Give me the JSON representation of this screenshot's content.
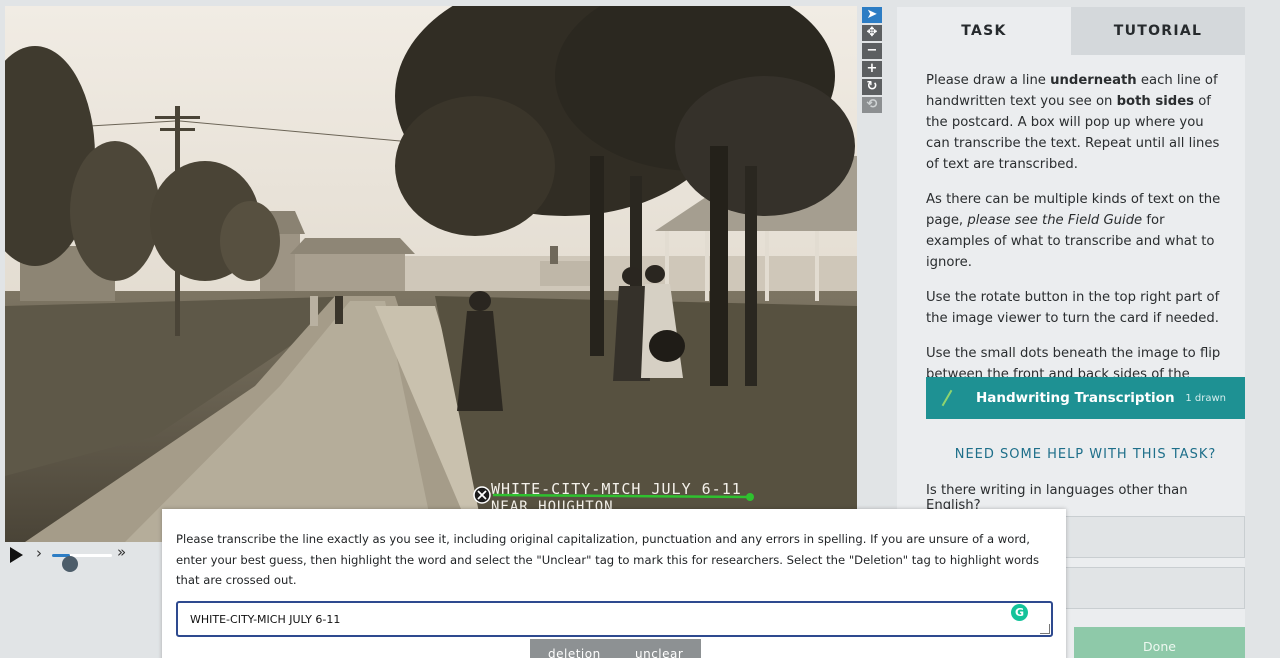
{
  "tabs": [
    {
      "label": "TASK",
      "active": true
    },
    {
      "label": "TUTORIAL",
      "active": false
    }
  ],
  "instructions": {
    "p1": {
      "t1": "Please draw a line ",
      "b1": "underneath",
      "t2": " each line of handwritten text you see on ",
      "b2": "both sides",
      "t3": " of the postcard. A box will pop up where you can transcribe the text. Repeat until all lines of text are transcribed."
    },
    "p2": {
      "t1": "As there can be multiple kinds of text on the page, ",
      "i1": "please see the Field Guide",
      "t2": " for examples of what to transcribe and what to ignore."
    },
    "p3": "Use the rotate button in the top right part of the image viewer to turn the card if needed.",
    "p4": "Use the small dots beneath the image to flip between the front and back sides of the postcard."
  },
  "tool": {
    "label": "Handwriting Transcription",
    "count": "1 drawn"
  },
  "help_link": "NEED SOME HELP WITH THIS TASK?",
  "question": "Is there writing in languages other than English?",
  "done_label": "Done",
  "toolbar": {
    "pointer": "➤",
    "move": "✥",
    "zoom_out": "−",
    "zoom_in": "+",
    "rotate": "↻",
    "reset": "⟲"
  },
  "playback": {
    "play": "▶",
    "step": "›",
    "fast": "»",
    "speed_fraction": 0.3
  },
  "image_text": {
    "line1": "WHITE-CITY-MICH JULY 6-11",
    "line2": "NEAR HOUGHTON"
  },
  "popup": {
    "instructions": "Please transcribe the line exactly as you see it, including original capitalization, punctuation and any errors in spelling. If you are unsure of a word, enter your best guess, then highlight the word and select the \"Unclear\" tag to mark this for researchers. Select the \"Deletion\" tag to highlight words that are crossed out.",
    "input_value": "WHITE-CITY-MICH JULY 6-11",
    "grammarly": "G",
    "tags": [
      "deletion",
      "unclear"
    ]
  },
  "colors": {
    "accent_teal": "#1e9193",
    "done_green": "#8ec9a9",
    "drawn_line": "#2fc12f",
    "toolbar_active": "#2d7dc4"
  }
}
